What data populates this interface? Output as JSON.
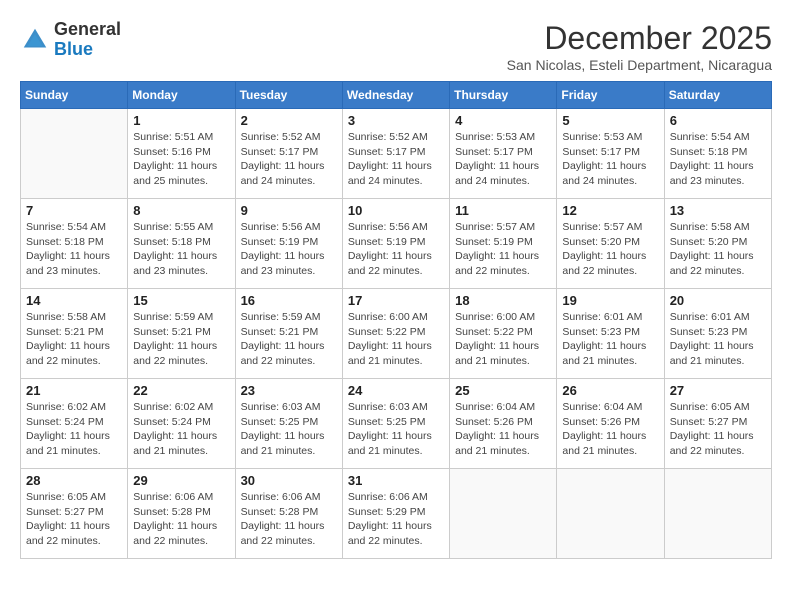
{
  "header": {
    "logo_general": "General",
    "logo_blue": "Blue",
    "month_title": "December 2025",
    "subtitle": "San Nicolas, Esteli Department, Nicaragua"
  },
  "days_of_week": [
    "Sunday",
    "Monday",
    "Tuesday",
    "Wednesday",
    "Thursday",
    "Friday",
    "Saturday"
  ],
  "weeks": [
    [
      {
        "day": "",
        "info": ""
      },
      {
        "day": "1",
        "info": "Sunrise: 5:51 AM\nSunset: 5:16 PM\nDaylight: 11 hours\nand 25 minutes."
      },
      {
        "day": "2",
        "info": "Sunrise: 5:52 AM\nSunset: 5:17 PM\nDaylight: 11 hours\nand 24 minutes."
      },
      {
        "day": "3",
        "info": "Sunrise: 5:52 AM\nSunset: 5:17 PM\nDaylight: 11 hours\nand 24 minutes."
      },
      {
        "day": "4",
        "info": "Sunrise: 5:53 AM\nSunset: 5:17 PM\nDaylight: 11 hours\nand 24 minutes."
      },
      {
        "day": "5",
        "info": "Sunrise: 5:53 AM\nSunset: 5:17 PM\nDaylight: 11 hours\nand 24 minutes."
      },
      {
        "day": "6",
        "info": "Sunrise: 5:54 AM\nSunset: 5:18 PM\nDaylight: 11 hours\nand 23 minutes."
      }
    ],
    [
      {
        "day": "7",
        "info": "Sunrise: 5:54 AM\nSunset: 5:18 PM\nDaylight: 11 hours\nand 23 minutes."
      },
      {
        "day": "8",
        "info": "Sunrise: 5:55 AM\nSunset: 5:18 PM\nDaylight: 11 hours\nand 23 minutes."
      },
      {
        "day": "9",
        "info": "Sunrise: 5:56 AM\nSunset: 5:19 PM\nDaylight: 11 hours\nand 23 minutes."
      },
      {
        "day": "10",
        "info": "Sunrise: 5:56 AM\nSunset: 5:19 PM\nDaylight: 11 hours\nand 22 minutes."
      },
      {
        "day": "11",
        "info": "Sunrise: 5:57 AM\nSunset: 5:19 PM\nDaylight: 11 hours\nand 22 minutes."
      },
      {
        "day": "12",
        "info": "Sunrise: 5:57 AM\nSunset: 5:20 PM\nDaylight: 11 hours\nand 22 minutes."
      },
      {
        "day": "13",
        "info": "Sunrise: 5:58 AM\nSunset: 5:20 PM\nDaylight: 11 hours\nand 22 minutes."
      }
    ],
    [
      {
        "day": "14",
        "info": "Sunrise: 5:58 AM\nSunset: 5:21 PM\nDaylight: 11 hours\nand 22 minutes."
      },
      {
        "day": "15",
        "info": "Sunrise: 5:59 AM\nSunset: 5:21 PM\nDaylight: 11 hours\nand 22 minutes."
      },
      {
        "day": "16",
        "info": "Sunrise: 5:59 AM\nSunset: 5:21 PM\nDaylight: 11 hours\nand 22 minutes."
      },
      {
        "day": "17",
        "info": "Sunrise: 6:00 AM\nSunset: 5:22 PM\nDaylight: 11 hours\nand 21 minutes."
      },
      {
        "day": "18",
        "info": "Sunrise: 6:00 AM\nSunset: 5:22 PM\nDaylight: 11 hours\nand 21 minutes."
      },
      {
        "day": "19",
        "info": "Sunrise: 6:01 AM\nSunset: 5:23 PM\nDaylight: 11 hours\nand 21 minutes."
      },
      {
        "day": "20",
        "info": "Sunrise: 6:01 AM\nSunset: 5:23 PM\nDaylight: 11 hours\nand 21 minutes."
      }
    ],
    [
      {
        "day": "21",
        "info": "Sunrise: 6:02 AM\nSunset: 5:24 PM\nDaylight: 11 hours\nand 21 minutes."
      },
      {
        "day": "22",
        "info": "Sunrise: 6:02 AM\nSunset: 5:24 PM\nDaylight: 11 hours\nand 21 minutes."
      },
      {
        "day": "23",
        "info": "Sunrise: 6:03 AM\nSunset: 5:25 PM\nDaylight: 11 hours\nand 21 minutes."
      },
      {
        "day": "24",
        "info": "Sunrise: 6:03 AM\nSunset: 5:25 PM\nDaylight: 11 hours\nand 21 minutes."
      },
      {
        "day": "25",
        "info": "Sunrise: 6:04 AM\nSunset: 5:26 PM\nDaylight: 11 hours\nand 21 minutes."
      },
      {
        "day": "26",
        "info": "Sunrise: 6:04 AM\nSunset: 5:26 PM\nDaylight: 11 hours\nand 21 minutes."
      },
      {
        "day": "27",
        "info": "Sunrise: 6:05 AM\nSunset: 5:27 PM\nDaylight: 11 hours\nand 22 minutes."
      }
    ],
    [
      {
        "day": "28",
        "info": "Sunrise: 6:05 AM\nSunset: 5:27 PM\nDaylight: 11 hours\nand 22 minutes."
      },
      {
        "day": "29",
        "info": "Sunrise: 6:06 AM\nSunset: 5:28 PM\nDaylight: 11 hours\nand 22 minutes."
      },
      {
        "day": "30",
        "info": "Sunrise: 6:06 AM\nSunset: 5:28 PM\nDaylight: 11 hours\nand 22 minutes."
      },
      {
        "day": "31",
        "info": "Sunrise: 6:06 AM\nSunset: 5:29 PM\nDaylight: 11 hours\nand 22 minutes."
      },
      {
        "day": "",
        "info": ""
      },
      {
        "day": "",
        "info": ""
      },
      {
        "day": "",
        "info": ""
      }
    ]
  ]
}
